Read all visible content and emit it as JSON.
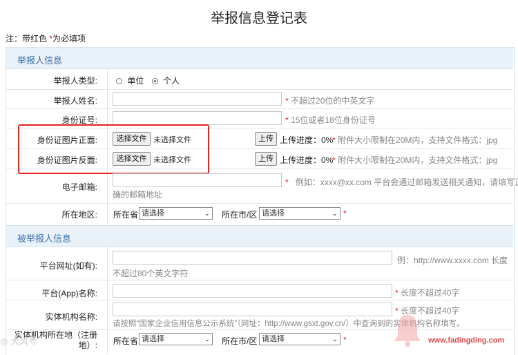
{
  "page": {
    "title": "举报信息登记表",
    "note_prefix": "注：带红色 ",
    "note_star": "*",
    "note_suffix": "为必填项"
  },
  "reporter": {
    "section_title": "举报人信息",
    "type_label": "举报人类型:",
    "type_options": [
      "单位",
      "个人"
    ],
    "type_selected": "个人",
    "name_label": "举报人姓名:",
    "name_value": "",
    "name_hint": "不超过20位的中英文字",
    "id_label": "身份证号:",
    "id_value": "",
    "id_hint": "15位或者18位身份证号",
    "id_front_label": "身份证图片正面:",
    "id_back_label": "身份证图片反面:",
    "choose_file": "选择文件",
    "no_file": "未选择文件",
    "upload": "上传",
    "progress": "上传进度：0%",
    "file_hint": "附件大小限制在20M内，支持文件格式：jpg",
    "email_label": "电子邮箱:",
    "email_value": "",
    "email_hint_1": "例如：xxxx@xx.com 平台会通过邮箱发送相关通知，请填写正",
    "email_hint_2": "确的邮箱地址",
    "region_label": "所在地区:",
    "province_label": "所在省",
    "city_label": "所在市/区",
    "select_placeholder": "请选择"
  },
  "reported": {
    "section_title": "被举报人信息",
    "url_label": "平台网址(如有):",
    "url_value": "",
    "url_hint_1": "例：http://www.xxxx.com 长度",
    "url_hint_2": "不超过80个英文字符",
    "app_label": "平台(App)名称:",
    "app_value": "",
    "app_hint": "长度不超过40字",
    "entity_label": "实体机构名称:",
    "entity_value": "",
    "entity_hint": "长度不超过40字",
    "entity_help": "请按照“国家企业信用信息公示系统”（网址：http://www.gsxt.gov.cn/）中查询到的实体机构名称填写。",
    "entity_loc_label_1": "实体机构所在地（注册",
    "entity_loc_label_2": "地）:",
    "province_label": "所在省",
    "city_label": "所在市/区",
    "select_placeholder": "请选择"
  },
  "watermarks": {
    "left": "大风号",
    "right": "www.fadingding.com"
  },
  "colors": {
    "required": "#e02020",
    "section_bg": "#eaf2f9",
    "section_text": "#3a6fa8",
    "highlight_box": "#e0261e"
  }
}
